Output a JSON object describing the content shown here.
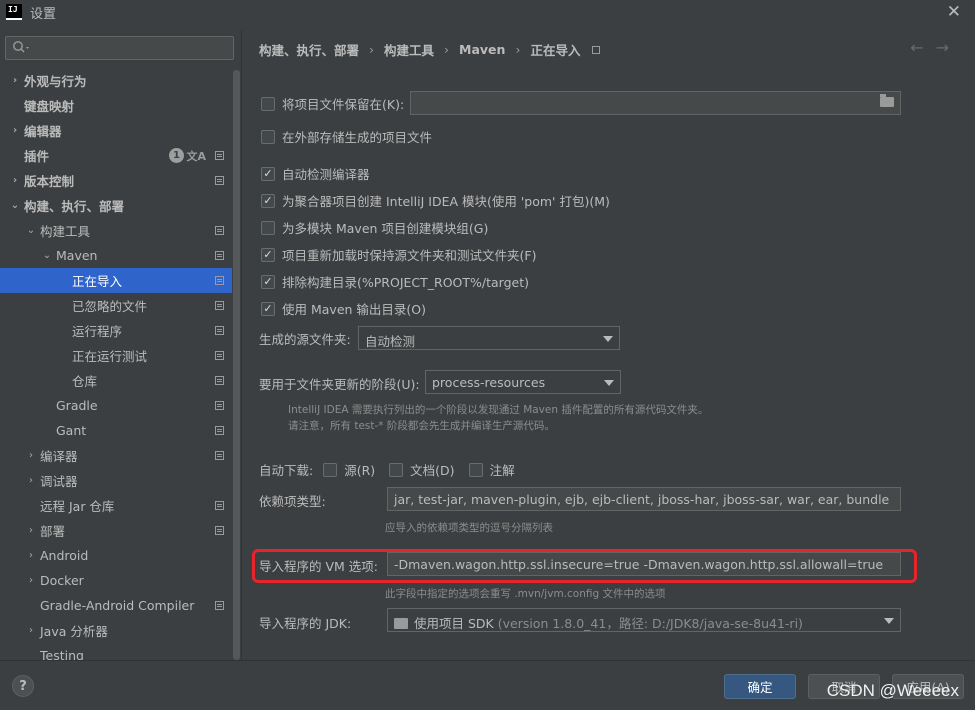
{
  "window": {
    "title": "设置",
    "logo": "IJ"
  },
  "search": {
    "placeholder": ""
  },
  "sidebar": {
    "items": [
      {
        "label": "外观与行为",
        "arrow": "›",
        "indent": 8,
        "bold": true,
        "settings": false
      },
      {
        "label": "键盘映射",
        "arrow": "",
        "indent": 8,
        "bold": true,
        "settings": false
      },
      {
        "label": "编辑器",
        "arrow": "›",
        "indent": 8,
        "bold": true,
        "settings": false
      },
      {
        "label": "插件",
        "arrow": "",
        "indent": 8,
        "bold": true,
        "settings": true,
        "badge": "1",
        "translate": true
      },
      {
        "label": "版本控制",
        "arrow": "›",
        "indent": 8,
        "bold": true,
        "settings": true
      },
      {
        "label": "构建、执行、部署",
        "arrow": "⌄",
        "indent": 8,
        "bold": true,
        "settings": false
      },
      {
        "label": "构建工具",
        "arrow": "⌄",
        "indent": 24,
        "bold": false,
        "settings": true
      },
      {
        "label": "Maven",
        "arrow": "⌄",
        "indent": 40,
        "bold": false,
        "settings": true
      },
      {
        "label": "正在导入",
        "arrow": "",
        "indent": 56,
        "bold": false,
        "settings": true,
        "selected": true
      },
      {
        "label": "已忽略的文件",
        "arrow": "",
        "indent": 56,
        "bold": false,
        "settings": true
      },
      {
        "label": "运行程序",
        "arrow": "",
        "indent": 56,
        "bold": false,
        "settings": true
      },
      {
        "label": "正在运行测试",
        "arrow": "",
        "indent": 56,
        "bold": false,
        "settings": true
      },
      {
        "label": "仓库",
        "arrow": "",
        "indent": 56,
        "bold": false,
        "settings": true
      },
      {
        "label": "Gradle",
        "arrow": "",
        "indent": 40,
        "bold": false,
        "settings": true
      },
      {
        "label": "Gant",
        "arrow": "",
        "indent": 40,
        "bold": false,
        "settings": true
      },
      {
        "label": "编译器",
        "arrow": "›",
        "indent": 24,
        "bold": false,
        "settings": true
      },
      {
        "label": "调试器",
        "arrow": "›",
        "indent": 24,
        "bold": false,
        "settings": false
      },
      {
        "label": "远程 Jar 仓库",
        "arrow": "",
        "indent": 24,
        "bold": false,
        "settings": true
      },
      {
        "label": "部署",
        "arrow": "›",
        "indent": 24,
        "bold": false,
        "settings": true
      },
      {
        "label": "Android",
        "arrow": "›",
        "indent": 24,
        "bold": false,
        "settings": false
      },
      {
        "label": "Docker",
        "arrow": "›",
        "indent": 24,
        "bold": false,
        "settings": false
      },
      {
        "label": "Gradle-Android Compiler",
        "arrow": "",
        "indent": 24,
        "bold": false,
        "settings": true
      },
      {
        "label": "Java 分析器",
        "arrow": "›",
        "indent": 24,
        "bold": false,
        "settings": false
      },
      {
        "label": "Testing",
        "arrow": "",
        "indent": 24,
        "bold": false,
        "settings": false
      }
    ]
  },
  "breadcrumb": {
    "b1": "构建、执行、部署",
    "b2": "构建工具",
    "b3": "Maven",
    "b4": "正在导入",
    "sep": "›"
  },
  "nav": {
    "back": "←",
    "forward": "→"
  },
  "form": {
    "keep_project_files": {
      "label": "将项目文件保留在(K):",
      "checked": false,
      "value": ""
    },
    "store_external": {
      "label": "在外部存储生成的项目文件",
      "checked": false
    },
    "detect_compiler": {
      "label": "自动检测编译器",
      "checked": true
    },
    "create_idea_module": {
      "label": "为聚合器项目创建 IntelliJ IDEA 模块(使用 'pom' 打包)(M)",
      "checked": true
    },
    "create_module_groups": {
      "label": "为多模块 Maven 项目创建模块组(G)",
      "checked": false
    },
    "keep_source_folders": {
      "label": "项目重新加载时保持源文件夹和测试文件夹(F)",
      "checked": true
    },
    "exclude_build_dir": {
      "label": "排除构建目录(%PROJECT_ROOT%/target)",
      "checked": true
    },
    "use_maven_output": {
      "label": "使用 Maven 输出目录(O)",
      "checked": true
    },
    "generated_sources": {
      "label": "生成的源文件夹:",
      "value": "自动检测"
    },
    "update_phase": {
      "label": "要用于文件夹更新的阶段(U):",
      "value": "process-resources"
    },
    "phase_hint_1": "IntelliJ IDEA 需要执行列出的一个阶段以发现通过 Maven 插件配置的所有源代码文件夹。",
    "phase_hint_2": "请注意，所有 test-* 阶段都会先生成并编译生产源代码。",
    "auto_download": {
      "label": "自动下载:",
      "sources": "源(R)",
      "docs": "文档(D)",
      "annotations": "注解"
    },
    "dependency_types": {
      "label": "依赖项类型:",
      "value": "jar, test-jar, maven-plugin, ejb, ejb-client, jboss-har, jboss-sar, war, ear, bundle",
      "hint": "应导入的依赖项类型的逗号分隔列表"
    },
    "vm_options": {
      "label": "导入程序的 VM 选项:",
      "value": "-Dmaven.wagon.http.ssl.insecure=true -Dmaven.wagon.http.ssl.allowall=true",
      "hint": "此字段中指定的选项会重写 .mvn/jvm.config 文件中的选项"
    },
    "jdk": {
      "label": "导入程序的 JDK:",
      "value": "使用项目 SDK",
      "detail": "(version 1.8.0_41，路径: D:/JDK8/java-se-8u41-ri)"
    }
  },
  "buttons": {
    "help": "?",
    "ok": "确定",
    "cancel": "取消",
    "apply": "应用(A)"
  },
  "watermark": "CSDN @Weeeex",
  "colors": {
    "background": "#3c3f41",
    "selection": "#2f65ca",
    "primary_button": "#365880",
    "highlight": "#e8242b"
  }
}
